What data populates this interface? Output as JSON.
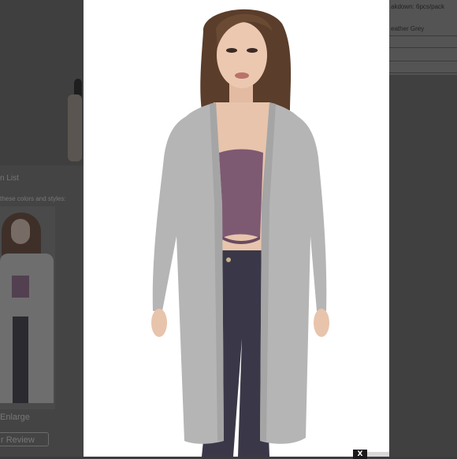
{
  "background_page": {
    "wishlist_label": "n List",
    "colors_styles_label": "these colors and styles:",
    "enlarge_label": "Enlarge",
    "review_button_label": "r Review",
    "pack_breakdown_label": "akdown: 6pcs/pack",
    "color_label": "eather Grey"
  },
  "lightbox": {
    "close_label": "X"
  },
  "colors": {
    "overlay": "#3c3c3c",
    "cardigan": "#b5b5b5",
    "bandeau": "#7d5a72",
    "pants": "#3a3848",
    "hair": "#5a3d2a",
    "skin": "#e8c4ac"
  }
}
